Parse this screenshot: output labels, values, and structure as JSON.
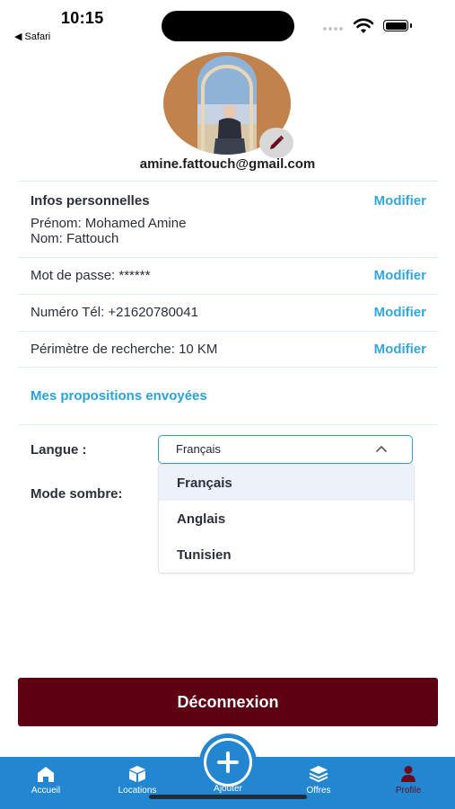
{
  "status": {
    "time": "10:15",
    "back_app": "◀ Safari"
  },
  "profile": {
    "email": "amine.fattouch@gmail.com"
  },
  "personal": {
    "title": "Infos personnelles",
    "modify": "Modifier",
    "first_name": "Prénom: Mohamed Amine",
    "last_name": "Nom: Fattouch"
  },
  "rows": [
    {
      "label": "Mot de passe: ******",
      "action": "Modifier"
    },
    {
      "label": "Numéro Tél: +21620780041",
      "action": "Modifier"
    },
    {
      "label": "Périmètre de recherche: 10 KM",
      "action": "Modifier"
    }
  ],
  "proposals_link": "Mes propositions envoyées",
  "language": {
    "label": "Langue :",
    "selected": "Français",
    "options": [
      "Français",
      "Anglais",
      "Tunisien"
    ]
  },
  "dark_mode": {
    "label": "Mode sombre:"
  },
  "logout_label": "Déconnexion",
  "tabs": [
    {
      "label": "Accueil",
      "icon": "home-icon"
    },
    {
      "label": "Locations",
      "icon": "box-icon"
    },
    {
      "label": "Ajouter",
      "icon": "plus-circle-icon"
    },
    {
      "label": "Offres",
      "icon": "layers-icon"
    },
    {
      "label": "Profile",
      "icon": "user-icon"
    }
  ],
  "colors": {
    "accent": "#2aa3d9",
    "tabbar": "#2287d0",
    "logout": "#5c0012",
    "active_tab": "#6a0b1d"
  }
}
